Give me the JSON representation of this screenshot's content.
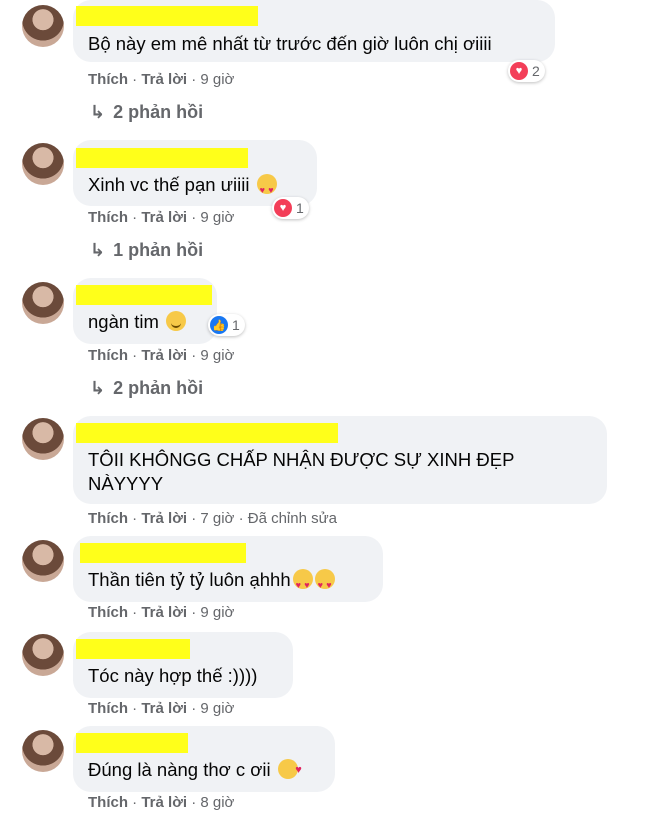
{
  "comments": [
    {
      "text": "Bộ này em mê nhất từ trước đến giờ luôn chị ơiiii",
      "emoji": "",
      "reaction": {
        "icon": "love-icon",
        "count": "2"
      },
      "meta": {
        "like": "Thích",
        "reply": "Trả lời",
        "time": "9 giờ",
        "edited": ""
      },
      "replies": "2 phản hồi"
    },
    {
      "text": "Xinh vc thế pạn ưiiii",
      "emoji": "heart-eyes",
      "reaction": {
        "icon": "love-icon",
        "count": "1"
      },
      "meta": {
        "like": "Thích",
        "reply": "Trả lời",
        "time": "9 giờ",
        "edited": ""
      },
      "replies": "1 phản hồi"
    },
    {
      "text": "ngàn tim",
      "emoji": "smile",
      "reaction": {
        "icon": "like-icon",
        "count": "1"
      },
      "meta": {
        "like": "Thích",
        "reply": "Trả lời",
        "time": "9 giờ",
        "edited": ""
      },
      "replies": "2 phản hồi"
    },
    {
      "text_line1": "TÔII KHÔNGG CHẤP NHẬN ĐƯỢC SỰ XINH ĐẸP",
      "text_line2": "NÀYYYY",
      "meta": {
        "like": "Thích",
        "reply": "Trả lời",
        "time": "7 giờ",
        "edited": "Đã chỉnh sửa"
      }
    },
    {
      "text": "Thần tiên tỷ tỷ luôn ạhhh",
      "emoji": "heart-eyes x2",
      "meta": {
        "like": "Thích",
        "reply": "Trả lời",
        "time": "9 giờ",
        "edited": ""
      }
    },
    {
      "text": "Tóc này hợp thế :))))",
      "meta": {
        "like": "Thích",
        "reply": "Trả lời",
        "time": "9 giờ",
        "edited": ""
      }
    },
    {
      "text": "Đúng là nàng thơ c ơii",
      "emoji": "smiling-face-with-hearts",
      "meta": {
        "like": "Thích",
        "reply": "Trả lời",
        "time": "8 giờ",
        "edited": ""
      }
    }
  ],
  "separator": "·",
  "colors": {
    "highlight": "#ffff1a",
    "bubble": "#f0f2f5",
    "meta": "#65676b",
    "love": "#f33e58",
    "like": "#1877f2"
  }
}
